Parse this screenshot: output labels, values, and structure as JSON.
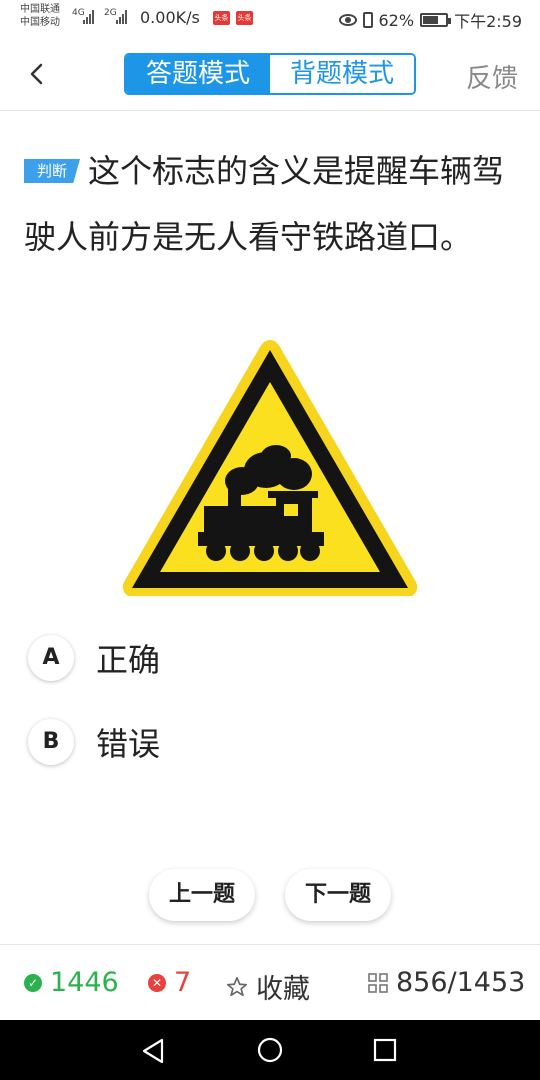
{
  "status_bar": {
    "carrier_1": "中国联通",
    "carrier_2": "中国移动",
    "network_1": "4G",
    "network_2": "2G",
    "speed": "0.00K/s",
    "app_icon_1": "头条",
    "app_icon_2": "头条",
    "battery": "62%",
    "time": "下午2:59"
  },
  "header": {
    "back_icon": "chevron-left-icon",
    "mode_answer": "答题模式",
    "mode_recite": "背题模式",
    "feedback": "反馈",
    "accent": "#1e96e8"
  },
  "question": {
    "type_tag": "判断",
    "text": "这个标志的含义是提醒车辆驾驶人前方是无人看守铁路道口。",
    "image": "unguarded-railway-crossing-sign"
  },
  "options": [
    {
      "key": "A",
      "label": "正确"
    },
    {
      "key": "B",
      "label": "错误"
    }
  ],
  "nav": {
    "prev": "上一题",
    "next": "下一题"
  },
  "bottom_bar": {
    "correct_count": "1446",
    "correct_color": "#2bb24c",
    "wrong_count": "7",
    "wrong_color": "#e8413c",
    "favorite": "收藏",
    "progress": "856/1453"
  }
}
